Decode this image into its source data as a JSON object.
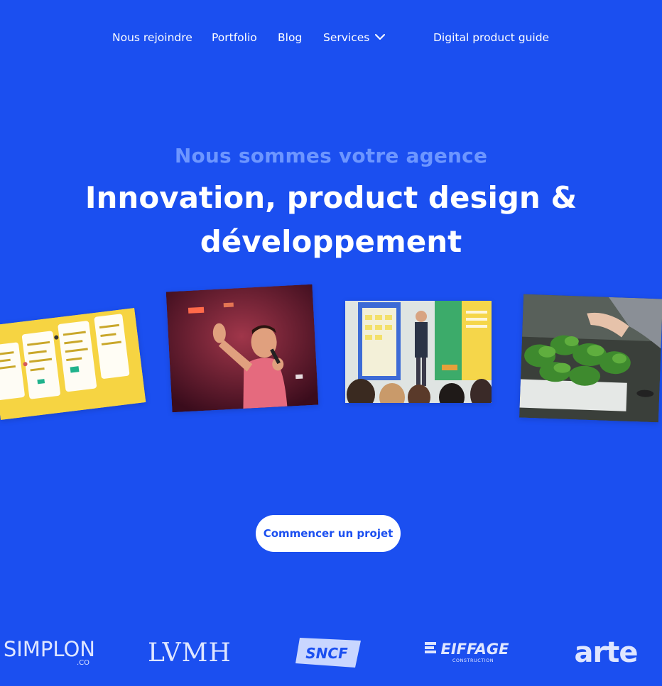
{
  "nav": {
    "items": [
      {
        "label": "Nous rejoindre"
      },
      {
        "label": "Portfolio"
      },
      {
        "label": "Blog"
      },
      {
        "label": "Services",
        "has_dropdown": true
      },
      {
        "label": "Digital product guide"
      }
    ]
  },
  "hero": {
    "eyebrow": "Nous sommes votre agence",
    "title_line1": "Innovation, product design &",
    "title_line2": "développement",
    "cta_label": "Commencer un projet"
  },
  "photos": [
    {
      "subject": "yellow app mockup screens"
    },
    {
      "subject": "speaker on stage with microphone"
    },
    {
      "subject": "workshop with whiteboard and audience"
    },
    {
      "subject": "hand touching basil plants"
    }
  ],
  "clients": {
    "logos": [
      {
        "name": "SIMPLON",
        "suffix": ".CO"
      },
      {
        "name": "LVMH"
      },
      {
        "name": "SNCF"
      },
      {
        "name": "EIFFAGE",
        "suffix": "CONSTRUCTION"
      },
      {
        "name": "arte"
      }
    ]
  },
  "colors": {
    "background": "#1b4ff0",
    "eyebrow": "#6d96ff",
    "text": "#ffffff",
    "cta_text": "#1b4ff0",
    "logo": "#dfe6ff"
  }
}
